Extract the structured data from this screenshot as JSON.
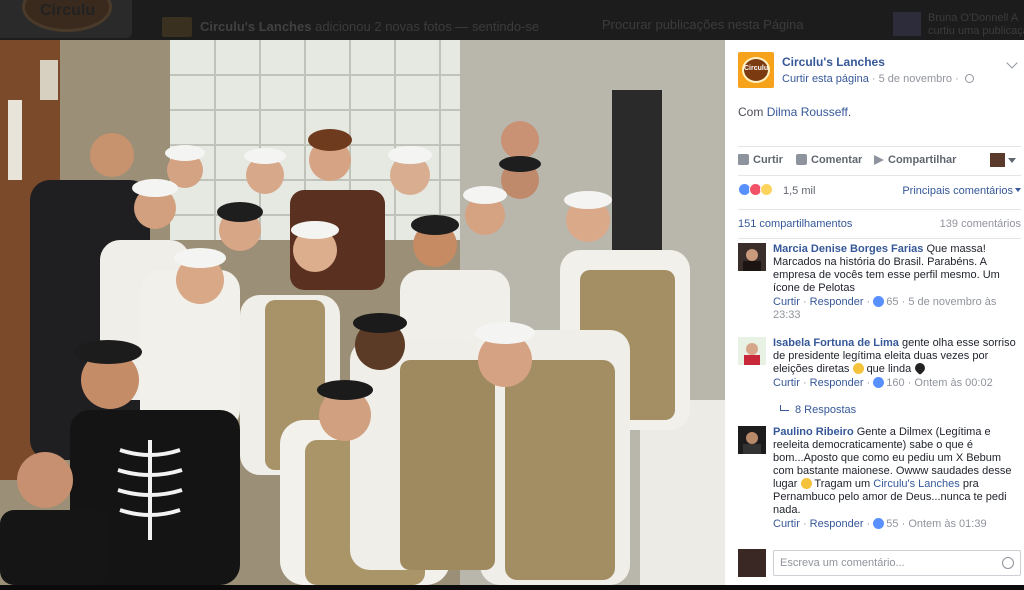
{
  "background": {
    "logo_text": "Circulu",
    "top_line_page": "Circulu's Lanches",
    "top_line_text": "adicionou 2 novas fotos —",
    "top_line_feeling": "sentindo-se",
    "search_placeholder": "Procurar publicações nesta Página",
    "user_name": "Bruna O'Donnell A",
    "user_sub": "curtiu uma publicação"
  },
  "post": {
    "page_name": "Circulu's Lanches",
    "page_logo_text": "Circulu",
    "follow_label": "Curtir esta página",
    "date": "5 de novembro",
    "with_prefix": "Com",
    "with_person": "Dilma Rousseff",
    "actions": {
      "like": "Curtir",
      "comment": "Comentar",
      "share": "Compartilhar"
    },
    "reactions_count": "1,5 mil",
    "sort_label": "Principais comentários",
    "shares": "151 compartilhamentos",
    "comments_count": "139 comentários",
    "colors": {
      "link": "#365899",
      "meta": "#90949c",
      "like_blue": "#5890ff",
      "love_red": "#f25268",
      "wow_yellow": "#fcd35d",
      "logo_orange": "#f6a21a"
    }
  },
  "comments": [
    {
      "author": "Marcia Denise Borges Farias",
      "text": "Que massa! Marcados na história do Brasil. Parabéns. A empresa de vocês tem esse perfil mesmo. Um ícone de Pelotas",
      "reply": "Responder",
      "likes": "65",
      "time": "5 de novembro às 23:33",
      "like_label": "Curtir"
    },
    {
      "author": "Isabela Fortuna de Lima",
      "text_before": "gente olha esse sorriso de presidente legítima eleita duas vezes por eleições diretas",
      "text_after": "que linda",
      "reply": "Responder",
      "likes": "160",
      "time": "Ontem às 00:02",
      "like_label": "Curtir",
      "replies": "8 Respostas"
    },
    {
      "author": "Paulino Ribeiro",
      "text_before": "Gente a Dilmex (Legítima e reeleita democraticamente) sabe o que é bom...Aposto que como eu pediu um X Bebum com bastante maionese. Owww saudades desse lugar",
      "text_middle": "Tragam um",
      "link": "Circulu's Lanches",
      "text_after": "pra Pernambuco pelo amor de Deus...nunca te pedi nada.",
      "reply": "Responder",
      "likes": "55",
      "time": "Ontem às 01:39",
      "like_label": "Curtir"
    }
  ],
  "write_comment_placeholder": "Escreva um comentário..."
}
